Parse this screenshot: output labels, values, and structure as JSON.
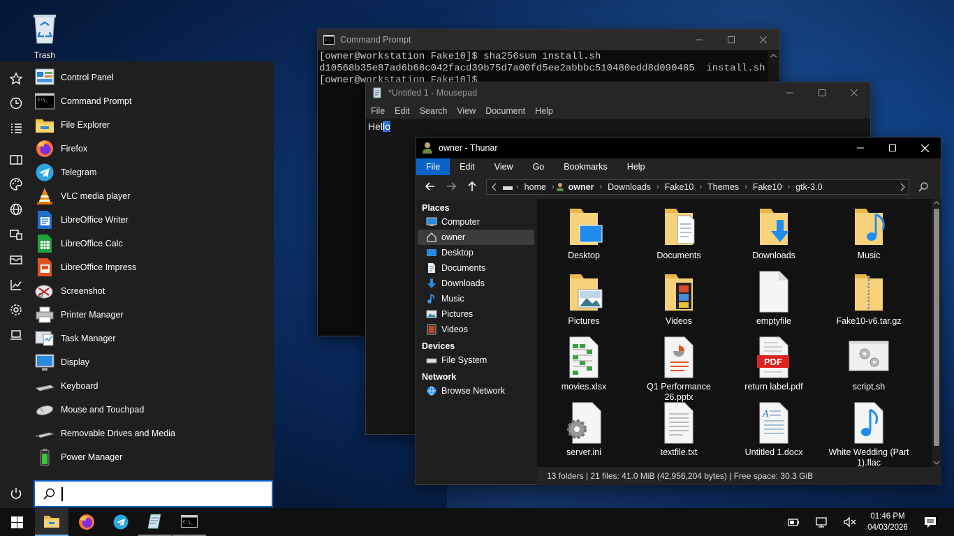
{
  "desktop": {
    "trash_label": "Trash"
  },
  "start_menu": {
    "apps": [
      {
        "label": "Control Panel",
        "icon": "control-panel-icon"
      },
      {
        "label": "Command Prompt",
        "icon": "command-prompt-icon"
      },
      {
        "label": "File Explorer",
        "icon": "file-explorer-icon"
      },
      {
        "label": "Firefox",
        "icon": "firefox-icon"
      },
      {
        "label": "Telegram",
        "icon": "telegram-icon"
      },
      {
        "label": "VLC media player",
        "icon": "vlc-icon"
      },
      {
        "label": "LibreOffice Writer",
        "icon": "writer-icon"
      },
      {
        "label": "LibreOffice Calc",
        "icon": "calc-icon"
      },
      {
        "label": "LibreOffice Impress",
        "icon": "impress-icon"
      },
      {
        "label": "Screenshot",
        "icon": "screenshot-icon"
      },
      {
        "label": "Printer Manager",
        "icon": "printer-icon"
      },
      {
        "label": "Task Manager",
        "icon": "task-manager-icon"
      },
      {
        "label": "Display",
        "icon": "display-icon"
      },
      {
        "label": "Keyboard",
        "icon": "keyboard-icon"
      },
      {
        "label": "Mouse and Touchpad",
        "icon": "mouse-icon"
      },
      {
        "label": "Removable Drives and Media",
        "icon": "removable-drive-icon"
      },
      {
        "label": "Power Manager",
        "icon": "battery-icon"
      }
    ],
    "search": {
      "value": ""
    }
  },
  "cmd": {
    "title": "Command Prompt",
    "lines": [
      "[owner@workstation Fake10]$ sha256sum install.sh",
      "d10568b35e87ad6b68c042facd39b75d7a00fd5ee2abbbc510480edd8d090485  install.sh",
      "[owner@workstation Fake10]$ "
    ]
  },
  "mousepad": {
    "title": "*Untitled 1 - Mousepad",
    "menu": [
      "File",
      "Edit",
      "Search",
      "View",
      "Document",
      "Help"
    ],
    "text_before": "Hel",
    "text_selected": "lo"
  },
  "thunar": {
    "title": "owner - Thunar",
    "menu": [
      "File",
      "Edit",
      "View",
      "Go",
      "Bookmarks",
      "Help"
    ],
    "path": [
      "home",
      "owner",
      "Downloads",
      "Fake10",
      "Themes",
      "Fake10",
      "gtk-3.0"
    ],
    "sidebar": {
      "places_header": "Places",
      "places": [
        "Computer",
        "owner",
        "Desktop",
        "Documents",
        "Downloads",
        "Music",
        "Pictures",
        "Videos"
      ],
      "devices_header": "Devices",
      "devices": [
        "File System"
      ],
      "network_header": "Network",
      "network": [
        "Browse Network"
      ]
    },
    "files": [
      {
        "name": "Desktop",
        "type": "folder-desktop"
      },
      {
        "name": "Documents",
        "type": "folder-documents"
      },
      {
        "name": "Downloads",
        "type": "folder-downloads"
      },
      {
        "name": "Music",
        "type": "folder-music"
      },
      {
        "name": "Pictures",
        "type": "folder-pictures"
      },
      {
        "name": "Videos",
        "type": "folder-videos"
      },
      {
        "name": "emptyfile",
        "type": "blank-file"
      },
      {
        "name": "Fake10-v6.tar.gz",
        "type": "archive"
      },
      {
        "name": "movies.xlsx",
        "type": "spreadsheet"
      },
      {
        "name": "Q1 Performance 26.pptx",
        "type": "presentation"
      },
      {
        "name": "return label.pdf",
        "type": "pdf"
      },
      {
        "name": "script.sh",
        "type": "script"
      },
      {
        "name": "server.ini",
        "type": "config"
      },
      {
        "name": "textfile.txt",
        "type": "text"
      },
      {
        "name": "Untitled 1.docx",
        "type": "document"
      },
      {
        "name": "White Wedding (Part 1).flac",
        "type": "audio"
      }
    ],
    "status": "13 folders  |  21 files: 41.0 MiB (42,956,204 bytes)  |  Free space: 30.3 GiB"
  },
  "taskbar": {
    "clock_time": "01:46 PM",
    "clock_date": "04/03/2026"
  }
}
